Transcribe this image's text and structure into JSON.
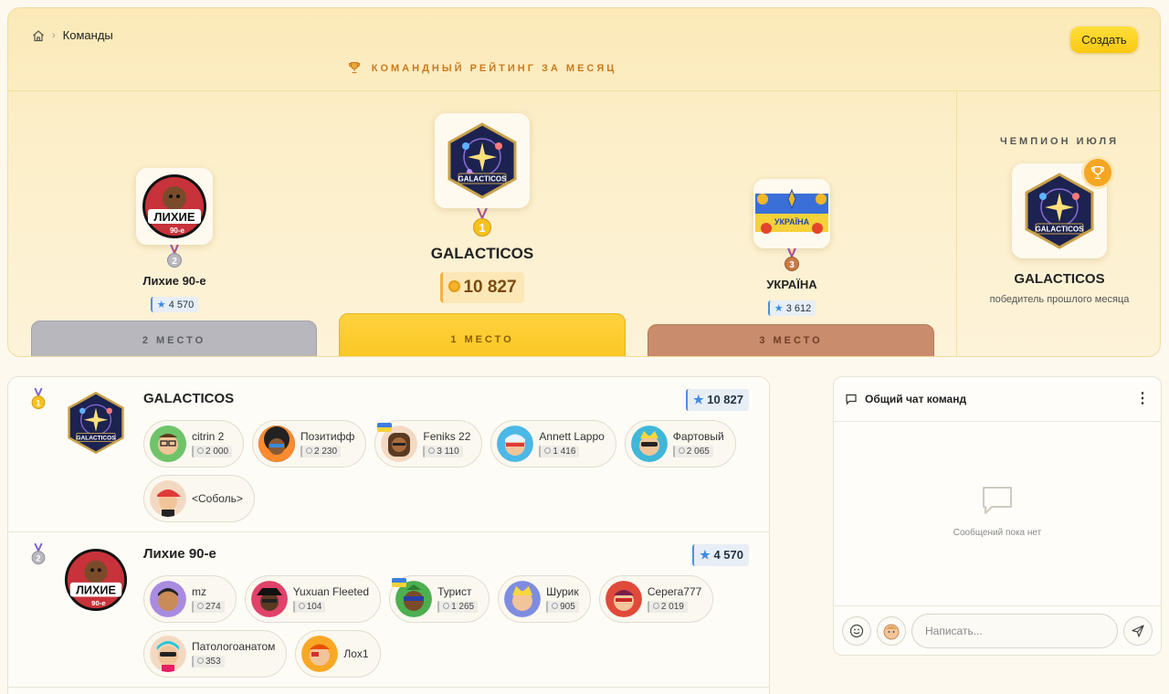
{
  "breadcrumb": {
    "current": "Команды"
  },
  "header": {
    "create_label": "Создать",
    "rating_title": "КОМАНДНЫЙ РЕЙТИНГ ЗА МЕСЯЦ"
  },
  "podium": {
    "first": {
      "name": "GALACTICOS",
      "score": "10 827",
      "place_label": "1 МЕСТО",
      "medal": "1"
    },
    "second": {
      "name": "Лихие 90-е",
      "score": "4 570",
      "place_label": "2 МЕСТО",
      "medal": "2"
    },
    "third": {
      "name": "УКРАЇНА",
      "score": "3 612",
      "place_label": "3 МЕСТО",
      "medal": "3"
    }
  },
  "champion": {
    "title": "ЧЕМПИОН ИЮЛЯ",
    "name": "GALACTICOS",
    "subtitle": "победитель прошлого месяца"
  },
  "teams": [
    {
      "name": "GALACTICOS",
      "score": "10 827",
      "medal": "1",
      "members": [
        {
          "name": "citrin 2",
          "score": "2 000",
          "icon": "avatar-glasses"
        },
        {
          "name": "Позитифф",
          "score": "2 230",
          "icon": "avatar-afro"
        },
        {
          "name": "Feniks 22",
          "score": "3 110",
          "icon": "avatar-dreadlocks"
        },
        {
          "name": "Annett Lappo",
          "score": "1 416",
          "icon": "avatar-mask"
        },
        {
          "name": "Фартовый",
          "score": "2 065",
          "icon": "avatar-sunglasses"
        },
        {
          "name": "<Соболь>",
          "score": "",
          "icon": "avatar-red-cap"
        }
      ]
    },
    {
      "name": "Лихие 90-е",
      "score": "4 570",
      "medal": "2",
      "members": [
        {
          "name": "mz",
          "score": "274",
          "icon": "avatar-boy"
        },
        {
          "name": "Yuxuan Fleeted",
          "score": "104",
          "icon": "avatar-hat"
        },
        {
          "name": "Турист",
          "score": "1 265",
          "icon": "avatar-ninja"
        },
        {
          "name": "Шурик",
          "score": "905",
          "icon": "avatar-blonde"
        },
        {
          "name": "Серега777",
          "score": "2 019",
          "icon": "avatar-red-mask"
        },
        {
          "name": "Патологоанатом",
          "score": "353",
          "icon": "avatar-cyan-hair"
        },
        {
          "name": "Лох1",
          "score": "",
          "icon": "avatar-yellow"
        }
      ]
    }
  ],
  "chat": {
    "title": "Общий чат команд",
    "empty_text": "Сообщений пока нет",
    "input_placeholder": "Написать..."
  },
  "colors": {
    "accent_yellow": "#fac622",
    "silver": "#b7b7bd",
    "bronze": "#c98c6c",
    "score_blue": "#3f8ae0"
  }
}
